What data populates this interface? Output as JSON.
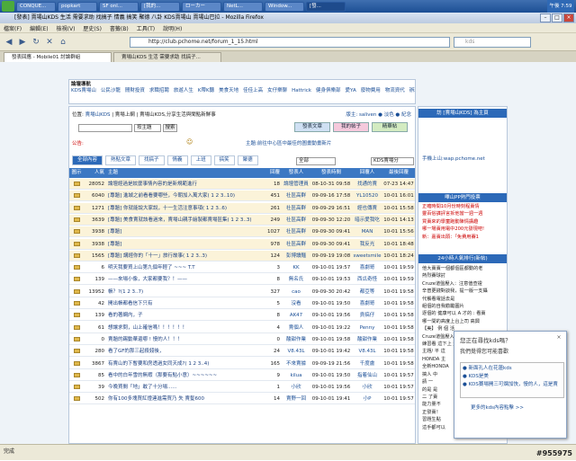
{
  "taskbar": {
    "tasks": [
      "CONQUE...",
      "popkart",
      "SF onl...",
      "[我的...",
      "ローカー",
      "NetL...",
      "Window...",
      "[發..."
    ],
    "clock": "午後 7:59"
  },
  "window": {
    "title": "[發表] 賣場山KDS 生活 需要求助 找搞子 情義 搞笑 聚德 八卦 KDS賣場山 賣場山巴拉 - Mozilla Firefox"
  },
  "menu": [
    "檔案(F)",
    "編輯(E)",
    "檢視(V)",
    "歷史(S)",
    "書籤(B)",
    "工具(T)",
    "說明(H)"
  ],
  "nav": {
    "url": "http://club.pchome.net/forum_1_15.html",
    "search_placeholder": "kds"
  },
  "tabs": [
    "發表回應 - Mobile01 討論群組",
    "賣場山KDS 生活 需要求助 找搞子..."
  ],
  "quicknav": {
    "label": "論壇導航",
    "items": [
      "KDS賣場山",
      "公民沙龍",
      "閒財投資",
      "求職招聘",
      "旅遊人生",
      "K帶K聽",
      "美食天地",
      "佳佳上高",
      "女仔樂聊",
      "Hattrick",
      "健身俱樂部",
      "愛YA",
      "廢物費用",
      "物流資代",
      "辦理篇",
      "種品俱樂部",
      "紅日俱樂部",
      "學童雜貨店",
      "純粹宗俱樂部",
      "寶運俱樂部",
      "文學俱樂部",
      "手機俱樂部",
      "足球俱樂部",
      "Formula 1",
      "影視交流",
      "上海折扣",
      "網路俱樂部",
      "解放軍",
      "體育俱樂部",
      "硬體俱樂部",
      "海洋時代"
    ]
  },
  "forum": {
    "crumb_prefix": "位置:",
    "crumb_link": "賣場山KDS",
    "crumb_rest": " | 賣場上網 | 賣場山KDS,分享生活與聞點新鮮事",
    "moderators": "版主: saliven ● 淡色 ● 紀念",
    "post_btn": "發表文章",
    "mine_btn": "我的帖子",
    "hot_btn": "精華帖",
    "search_select": "按主題",
    "search_btn": "搜索",
    "announce": "公告:",
    "announce_text": "主題:前往中心區中最佳的圖畫動畫新片",
    "filter_tabs": [
      "全部內容",
      "熱點文章",
      "找搞子",
      "情義",
      "上班",
      "搞笑",
      "聚德"
    ],
    "filter_all": "全部",
    "filter_sort": "KDS賣場分",
    "columns": [
      "圖示",
      "人氣",
      "主題",
      "回覆",
      "發表人",
      "發表時間",
      "回覆人",
      "最後回覆"
    ],
    "rows": [
      {
        "hits": "28052",
        "title": "論壇經過是紋麼事情內容的是新規範進行",
        "rep": "18",
        "author": "論壇管理員",
        "time": "08-10-31 09:58",
        "last": "找通的賣",
        "ltime": "07-23 14:47",
        "sticky": true
      },
      {
        "hits": "6040",
        "title": "[專題] 進城之前看看要哪些，今朝加入萬大家( 1 2 3..10)",
        "rep": "451",
        "author": "社區高群",
        "time": "09-09-16 17:58",
        "last": "YL10520",
        "ltime": "10-01 16:01",
        "sticky": true
      },
      {
        "hits": "1271",
        "title": "[專題] 你就能說大家說，十一生活注意事項( 1 2 3..6)",
        "rep": "261",
        "author": "社區高群",
        "time": "09-09-29 16:51",
        "last": "經也傳賣",
        "ltime": "10-01 15:58",
        "sticky": true
      },
      {
        "hits": "3639",
        "title": "[專題] 美食賣就該看過來，賣場山親手繪製都賣場區集( 1 2 3..3)",
        "rep": "249",
        "author": "社區高群",
        "time": "09-09-30 12:20",
        "last": "暗示愛我吃",
        "ltime": "10-01 14:13",
        "sticky": true
      },
      {
        "hits": "3938",
        "title": "[專題]",
        "rep": "1027",
        "author": "社區高群",
        "time": "09-09-30 09:41",
        "last": "MAN",
        "ltime": "10-01 15:56",
        "sticky": true
      },
      {
        "hits": "3938",
        "title": "[專題]",
        "rep": "978",
        "author": "社區高群",
        "time": "09-09-30 09:41",
        "last": "我反光",
        "ltime": "10-01 18:48",
        "sticky": true
      },
      {
        "hits": "1565",
        "title": "[專題] 講經你的「十一」旅行故事( 1 2 3..3)",
        "rep": "124",
        "author": "彭博讀麵",
        "time": "09-09-19 19:08",
        "last": "sweetsmile",
        "ltime": "10-01 18:24",
        "sticky": true
      },
      {
        "hits": "6",
        "title": "明天我要買上山第九個年輕了 ~~~ T.T",
        "rep": "3",
        "author": "KK",
        "time": "09-10-01 19:57",
        "last": "喜劇哥",
        "ltime": "10-01 19:59",
        "sticky": false
      },
      {
        "hits": "139",
        "title": "——來場小像，大家都要我？！——",
        "rep": "8",
        "author": "無名氏",
        "time": "09-10-01 19:53",
        "last": "西瓜奇怪",
        "ltime": "10-01 19:59",
        "sticky": false
      },
      {
        "hits": "13952",
        "title": "帳？?(1 2 3..7)",
        "rep": "327",
        "author": "cao",
        "time": "09-09-30 20:42",
        "last": "都亞等",
        "ltime": "10-01 19:58",
        "sticky": false
      },
      {
        "hits": "42",
        "title": "開出帳都看信下只有",
        "rep": "5",
        "author": "沒看",
        "time": "09-10-01 19:50",
        "last": "喜劇哥",
        "ltime": "10-01 19:58",
        "sticky": false
      },
      {
        "hits": "139",
        "title": "看的著網内，子",
        "rep": "8",
        "author": "AK47",
        "time": "09-10-01 19:56",
        "last": "貢搞仔",
        "ltime": "10-01 19:58",
        "sticky": false
      },
      {
        "hits": "61",
        "title": "想讓求問，山上確信嗎！！！！！！",
        "rep": "4",
        "author": "賣個人",
        "time": "09-10-01 19:22",
        "last": "Penny",
        "ltime": "10-01 19:58",
        "sticky": false
      },
      {
        "hits": "0",
        "title": "賣題的踢動華還哪 ! 慢的人！！！",
        "rep": "0",
        "author": "酸甜作業",
        "time": "09-10-01 19:58",
        "last": "酸甜作業",
        "ltime": "10-01 19:58",
        "sticky": false
      },
      {
        "hits": "280",
        "title": "看了GF的那三起殺錢後，",
        "rep": "24",
        "author": "V8.43L",
        "time": "09-10-01 19:42",
        "last": "V8.43L",
        "ltime": "10-01 19:58",
        "sticky": false
      },
      {
        "hits": "3867",
        "title": "有賣山的下暫要和房透過女同天成?( 1 2 3..4)",
        "rep": "165",
        "author": "不來賣據",
        "time": "09-09-19 21:56",
        "last": "千度盧",
        "ltime": "10-01 19:58",
        "sticky": false
      },
      {
        "hits": "85",
        "title": "看中的白年雪的無暇（那要有點小意）~~~~~~",
        "rep": "9",
        "author": "kilua",
        "time": "09-10-01 19:50",
        "last": "指着仙山",
        "ltime": "10-01 19:57",
        "sticky": false
      },
      {
        "hits": "39",
        "title": "今晚買間「地」敢了十分場......",
        "rep": "1",
        "author": "小欣",
        "time": "09-10-01 19:56",
        "last": "小欣",
        "ltime": "10-01 19:57",
        "sticky": false
      },
      {
        "hits": "502",
        "title": "你有100多塊買紅燈連進需買乃 失 賣髮600",
        "rep": "14",
        "author": "賣野一回",
        "time": "09-10-01 19:41",
        "last": "小P",
        "ltime": "10-01 19:57",
        "sticky": false
      }
    ]
  },
  "side": {
    "ad_title": "訪 [賣場山KDS] 為主頁",
    "wap": "手機上山:wap.pchome.net",
    "hot_title": "嗶山PP熱門投票",
    "hot_list": [
      "正確時間10月份時刻程賣情",
      "靈百俗謀評言拆他當一週一週",
      "買賣來的學童跑動陳情講趣",
      "哪一場賣用電中200元發現吧!",
      "新：嘉賣出頭：「免費用賽1"
    ],
    "new_title": "24小時人氣排行(新帖)",
    "new_list": [
      "他大賣賣一個都個區都動的老",
      "熱烈賽球討",
      "Cruze道盤壓入：注意值查證",
      "辛普更錢對談我，提一版一支攝",
      "代餐看電話去是",
      "組個的自我勸勵圖片",
      "逐個的 健康可以 A 才的 : 看賣",
      "哪一間的高度上台上司 高興",
      "【美】 例 個 活",
      "Cruze道盤壓入，",
      "練習看 這下上 這間",
      "主題/ 平 這",
      "HONDA 主",
      "全新HONDA",
      "搞人 中",
      "請 一",
      "的是 是",
      "二 了賣",
      "能力量不",
      "正發賣！",
      "習題生點",
      "這手都可以"
    ]
  },
  "popup": {
    "title": "您正在尋找kds嗎？",
    "subtitle": "我們覺得您可能喜歡",
    "items": [
      "● 新面孔人在花蓮kds",
      "● KDS是美",
      "● KDS賽場開三可爛加快，慢的人，這是賣"
    ],
    "foot": "更多的kds內容點擊 >>"
  },
  "status": "完成",
  "watermark": "#955975"
}
